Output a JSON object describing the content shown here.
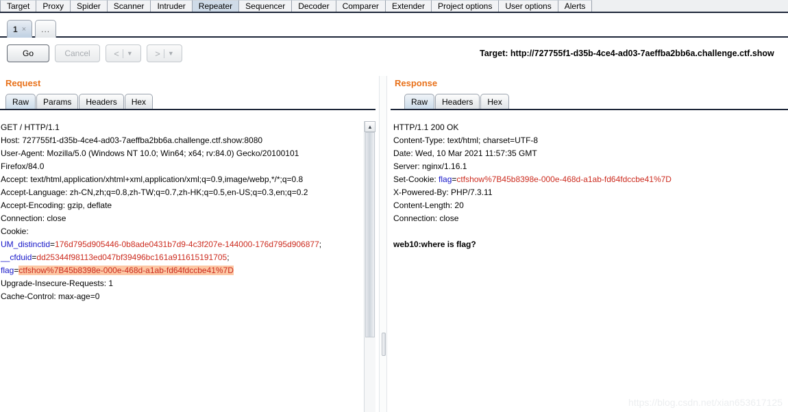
{
  "main_tabs": [
    {
      "label": "Target",
      "selected": false
    },
    {
      "label": "Proxy",
      "selected": false
    },
    {
      "label": "Spider",
      "selected": false
    },
    {
      "label": "Scanner",
      "selected": false
    },
    {
      "label": "Intruder",
      "selected": false
    },
    {
      "label": "Repeater",
      "selected": true
    },
    {
      "label": "Sequencer",
      "selected": false
    },
    {
      "label": "Decoder",
      "selected": false
    },
    {
      "label": "Comparer",
      "selected": false
    },
    {
      "label": "Extender",
      "selected": false
    },
    {
      "label": "Project options",
      "selected": false
    },
    {
      "label": "User options",
      "selected": false
    },
    {
      "label": "Alerts",
      "selected": false
    }
  ],
  "repeater_tabs": {
    "items": [
      {
        "label": "1",
        "close": "×",
        "selected": true
      }
    ],
    "add_label": "..."
  },
  "toolbar": {
    "go_label": "Go",
    "cancel_label": "Cancel",
    "back_arrow": "<",
    "back_caret": "▼",
    "forward_arrow": ">",
    "forward_caret": "▼",
    "target_label": "Target: http://727755f1-d35b-4ce4-ad03-7aeffba2bb6a.challenge.ctf.show"
  },
  "request": {
    "title": "Request",
    "tabs": [
      {
        "label": "Raw",
        "selected": true
      },
      {
        "label": "Params",
        "selected": false
      },
      {
        "label": "Headers",
        "selected": false
      },
      {
        "label": "Hex",
        "selected": false
      }
    ],
    "lines": [
      [
        {
          "t": "GET / HTTP/1.1"
        }
      ],
      [
        {
          "t": "Host: 727755f1-d35b-4ce4-ad03-7aeffba2bb6a.challenge.ctf.show:8080"
        }
      ],
      [
        {
          "t": "User-Agent: Mozilla/5.0 (Windows NT 10.0; Win64; x64; rv:84.0) Gecko/20100101"
        }
      ],
      [
        {
          "t": "Firefox/84.0"
        }
      ],
      [
        {
          "t": "Accept: text/html,application/xhtml+xml,application/xml;q=0.9,image/webp,*/*;q=0.8"
        }
      ],
      [
        {
          "t": "Accept-Language: zh-CN,zh;q=0.8,zh-TW;q=0.7,zh-HK;q=0.5,en-US;q=0.3,en;q=0.2"
        }
      ],
      [
        {
          "t": "Accept-Encoding: gzip, deflate"
        }
      ],
      [
        {
          "t": "Connection: close"
        }
      ],
      [
        {
          "t": "Cookie:"
        }
      ],
      [
        {
          "t": "UM_distinctid",
          "c": "k-blue"
        },
        {
          "t": "="
        },
        {
          "t": "176d795d905446-0b8ade0431b7d9-4c3f207e-144000-176d795d906877",
          "c": "v-red"
        },
        {
          "t": ";"
        }
      ],
      [
        {
          "t": "__cfduid",
          "c": "k-blue"
        },
        {
          "t": "="
        },
        {
          "t": "dd25344f98113ed047bf39496bc161a911615191705",
          "c": "v-red"
        },
        {
          "t": ";"
        }
      ],
      [
        {
          "t": "flag",
          "c": "k-blue"
        },
        {
          "t": "="
        },
        {
          "t": "ctfshow%7B45b8398e-000e-468d-a1ab-fd64fdccbe41%7D",
          "c": "v-red hl"
        }
      ],
      [
        {
          "t": "Upgrade-Insecure-Requests: 1"
        }
      ],
      [
        {
          "t": "Cache-Control: max-age=0"
        }
      ]
    ]
  },
  "response": {
    "title": "Response",
    "tabs": [
      {
        "label": "Raw",
        "selected": true
      },
      {
        "label": "Headers",
        "selected": false
      },
      {
        "label": "Hex",
        "selected": false
      }
    ],
    "lines": [
      [
        {
          "t": "HTTP/1.1 200 OK"
        }
      ],
      [
        {
          "t": "Content-Type: text/html; charset=UTF-8"
        }
      ],
      [
        {
          "t": "Date: Wed, 10 Mar 2021 11:57:35 GMT"
        }
      ],
      [
        {
          "t": "Server: nginx/1.16.1"
        }
      ],
      [
        {
          "t": "Set-Cookie: "
        },
        {
          "t": "flag",
          "c": "k-blue"
        },
        {
          "t": "="
        },
        {
          "t": "ctfshow%7B45b8398e-000e-468d-a1ab-fd64fdccbe41%7D",
          "c": "v-red"
        }
      ],
      [
        {
          "t": "X-Powered-By: PHP/7.3.11"
        }
      ],
      [
        {
          "t": "Content-Length: 20"
        }
      ],
      [
        {
          "t": "Connection: close"
        }
      ],
      [
        {
          "t": ""
        }
      ],
      [
        {
          "t": "web10:where is flag?",
          "c": "bold"
        }
      ]
    ]
  },
  "watermark": "https://blog.csdn.net/xian653617125"
}
